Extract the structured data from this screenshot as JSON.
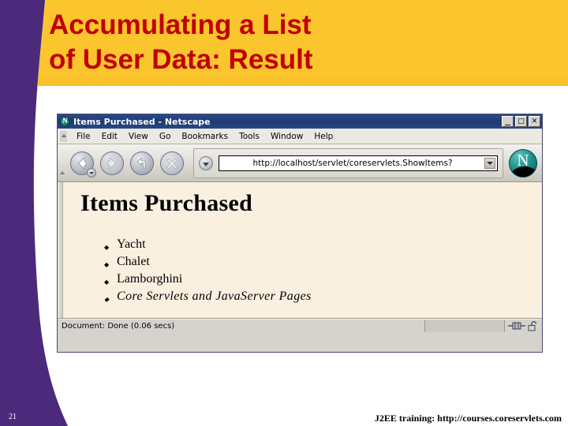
{
  "slide": {
    "title_lines": [
      "Accumulating a List",
      "of User Data: Result"
    ],
    "page_number": "21",
    "footer": "J2EE training: http://courses.coreservlets.com",
    "colors": {
      "band": "#fbc52d",
      "sidebar": "#4b2a7b",
      "title_text": "#c00000",
      "page_bg": "#faf0e0"
    }
  },
  "browser": {
    "titlebar": {
      "logo_icon": "netscape-logo-icon",
      "title": "Items Purchased - Netscape",
      "buttons": [
        {
          "name": "minimize",
          "glyph": "_"
        },
        {
          "name": "maximize",
          "glyph": "□"
        },
        {
          "name": "close",
          "glyph": "✕"
        }
      ]
    },
    "menubar": [
      "File",
      "Edit",
      "View",
      "Go",
      "Bookmarks",
      "Tools",
      "Window",
      "Help"
    ],
    "toolbar": {
      "buttons": [
        {
          "name": "back-button",
          "icon": "arrow-left-icon"
        },
        {
          "name": "forward-button",
          "icon": "arrow-right-icon"
        },
        {
          "name": "reload-button",
          "icon": "reload-arrow-icon"
        },
        {
          "name": "stop-button",
          "icon": "close-x-icon"
        }
      ],
      "url_value": "http://localhost/servlet/coreservlets.ShowItems?",
      "url_placeholder": "Enter address",
      "logo_letter": "N"
    },
    "content": {
      "heading": "Items Purchased",
      "items": [
        {
          "text": "Yacht",
          "style": "normal"
        },
        {
          "text": "Chalet",
          "style": "normal"
        },
        {
          "text": "Lamborghini",
          "style": "normal"
        },
        {
          "text": "Core Servlets and JavaServer Pages",
          "style": "italic"
        }
      ]
    },
    "statusbar": {
      "text": "Document: Done (0.06 secs)",
      "icons": [
        "network-connection-icon",
        "unlocked-padlock-icon"
      ]
    }
  }
}
